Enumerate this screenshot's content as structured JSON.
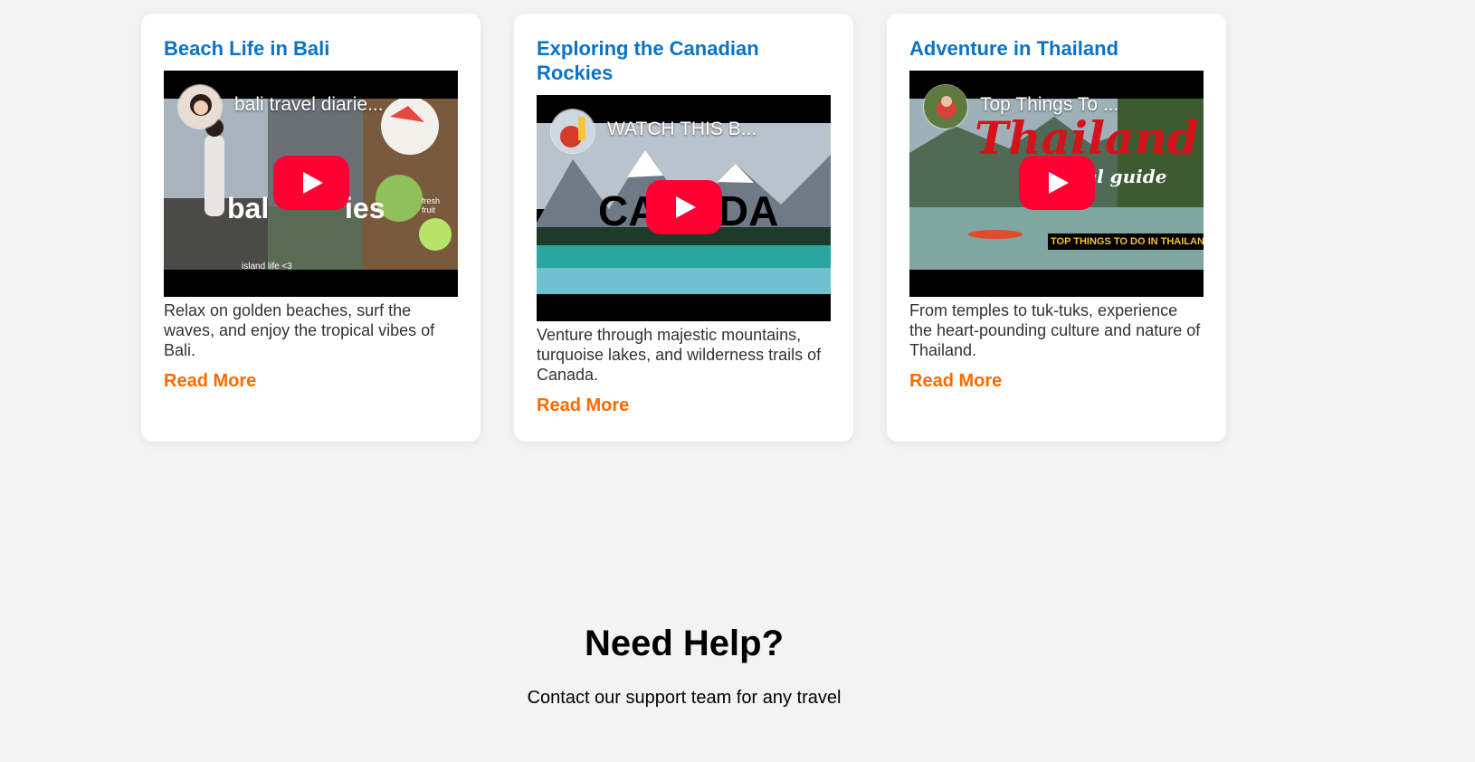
{
  "cards": [
    {
      "title": "Beach Life in Bali",
      "video_title": "bali travel diarie...",
      "thumbnail_text": "bal",
      "thumbnail_text_2": "ies",
      "thumbnail_caption": "island life <3",
      "thumbnail_side_note": "fresh fruit",
      "description": "Relax on golden beaches, surf the waves, and enjoy the tropical vibes of Bali.",
      "link": "Read More"
    },
    {
      "title": "Exploring the Canadian Rockies",
      "video_title": "WATCH THIS B...",
      "thumbnail_text": "CANADA",
      "description": "Venture through majestic mountains, turquoise lakes, and wilderness trails of Canada.",
      "link": "Read More"
    },
    {
      "title": "Adventure in Thailand",
      "video_title": "Top Things To ...",
      "thumbnail_text": "Thailand",
      "thumbnail_subtext": "travel guide",
      "thumbnail_caption": "TOP THINGS TO DO IN THAILAND",
      "description": "From temples to tuk-tuks, experience the heart-pounding culture and nature of Thailand.",
      "link": "Read More"
    }
  ],
  "help": {
    "heading": "Need Help?",
    "text": "Contact our support team for any travel"
  },
  "colors": {
    "title": "#0a73c6",
    "link": "#ff6a00",
    "play": "#ff0033",
    "background": "#f3f3f3"
  }
}
